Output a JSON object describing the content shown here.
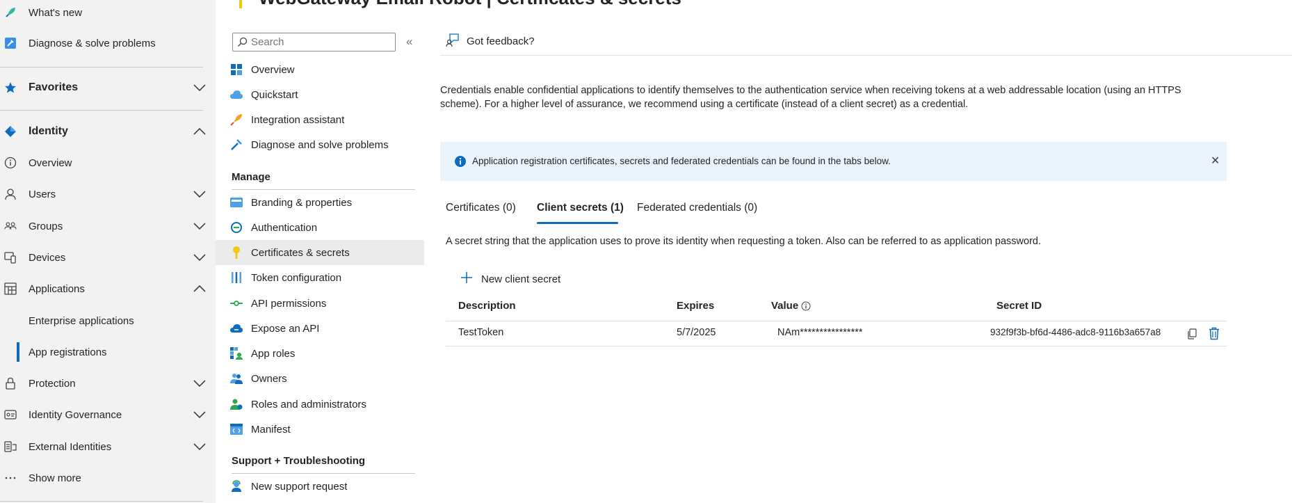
{
  "left_nav": {
    "items": [
      {
        "label": "What's new",
        "icon": "rocket-icon"
      },
      {
        "label": "Diagnose & solve problems",
        "icon": "wrench-icon"
      },
      {
        "label": "Favorites",
        "icon": "star-icon",
        "expanded": false
      },
      {
        "label": "Identity",
        "icon": "identity-diamond-icon",
        "expanded": true
      },
      {
        "label": "Overview",
        "icon": "info-icon"
      },
      {
        "label": "Users",
        "icon": "user-icon",
        "expanded": false
      },
      {
        "label": "Groups",
        "icon": "groups-icon",
        "expanded": false
      },
      {
        "label": "Devices",
        "icon": "devices-icon",
        "expanded": false
      },
      {
        "label": "Applications",
        "icon": "applications-icon",
        "expanded": true
      },
      {
        "label": "Enterprise applications"
      },
      {
        "label": "App registrations",
        "active": true
      },
      {
        "label": "Protection",
        "icon": "lock-icon",
        "expanded": false
      },
      {
        "label": "Identity Governance",
        "icon": "governance-icon",
        "expanded": false
      },
      {
        "label": "External Identities",
        "icon": "external-identities-icon",
        "expanded": false
      },
      {
        "label": "Show more",
        "icon": "ellipsis-icon"
      }
    ]
  },
  "header": {
    "title": "WebGateway Email Robot | Certificates & secrets",
    "title_icon": "key-icon"
  },
  "resource_menu": {
    "search_placeholder": "Search",
    "collapse_glyph": "«",
    "items_top": [
      {
        "label": "Overview",
        "icon": "grid-icon"
      },
      {
        "label": "Quickstart",
        "icon": "cloud-icon"
      },
      {
        "label": "Integration assistant",
        "icon": "rocket-icon"
      },
      {
        "label": "Diagnose and solve problems",
        "icon": "wrench-icon"
      }
    ],
    "manage_heading": "Manage",
    "manage_items": [
      {
        "label": "Branding & properties",
        "icon": "branding-icon"
      },
      {
        "label": "Authentication",
        "icon": "authentication-icon"
      },
      {
        "label": "Certificates & secrets",
        "icon": "key-icon",
        "selected": true
      },
      {
        "label": "Token configuration",
        "icon": "token-config-icon"
      },
      {
        "label": "API permissions",
        "icon": "api-permissions-icon"
      },
      {
        "label": "Expose an API",
        "icon": "cloud-api-icon"
      },
      {
        "label": "App roles",
        "icon": "app-roles-icon"
      },
      {
        "label": "Owners",
        "icon": "owners-icon"
      },
      {
        "label": "Roles and administrators",
        "icon": "roles-admin-icon"
      },
      {
        "label": "Manifest",
        "icon": "manifest-icon"
      }
    ],
    "support_heading": "Support + Troubleshooting",
    "support_items": [
      {
        "label": "New support request",
        "icon": "support-person-icon"
      }
    ]
  },
  "main": {
    "feedback_label": "Got feedback?",
    "intro_text": "Credentials enable confidential applications to identify themselves to the authentication service when receiving tokens at a web addressable location (using an HTTPS scheme). For a higher level of assurance, we recommend using a certificate (instead of a client secret) as a credential.",
    "info_bar_text": "Application registration certificates, secrets and federated credentials can be found in the tabs below.",
    "close_glyph": "✕",
    "tabs": [
      {
        "label": "Certificates (0)"
      },
      {
        "label": "Client secrets (1)",
        "active": true
      },
      {
        "label": "Federated credentials (0)"
      }
    ],
    "secrets_description": "A secret string that the application uses to prove its identity when requesting a token. Also can be referred to as application password.",
    "new_secret_label": "New client secret",
    "table": {
      "columns": [
        "Description",
        "Expires",
        "Value",
        "Secret ID"
      ],
      "rows": [
        {
          "description": "TestToken",
          "expires": "5/7/2025",
          "value": "NAm****************",
          "secret_id": "932f9f3b-bf6d-4486-adc8-9116b3a657a8"
        }
      ]
    }
  },
  "colors": {
    "accent": "#0f6cbd",
    "nav_bg": "#f2f2f2",
    "info_bg": "#ebf3fc",
    "delete": "#0f6cbd",
    "key_yellow": "#f2c811"
  }
}
